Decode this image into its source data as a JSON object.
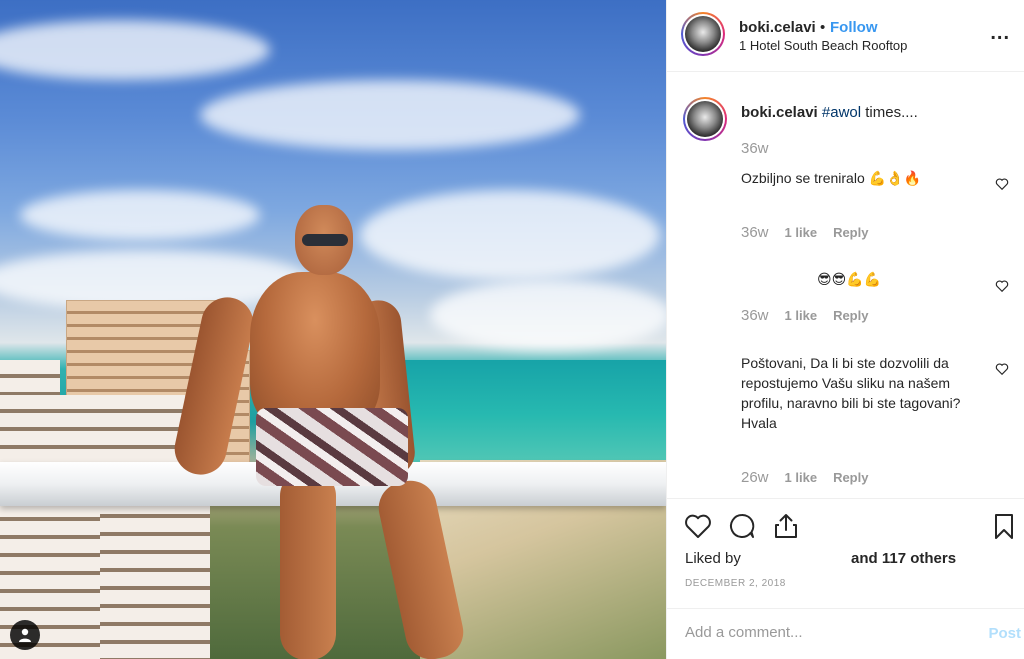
{
  "post": {
    "username": "boki.celavi",
    "dot": "•",
    "follow_label": "Follow",
    "location": "1 Hotel South Beach Rooftop",
    "more_label": "...",
    "caption_username": "boki.celavi",
    "caption_hashtag": "#awol",
    "caption_text": " times....",
    "caption_time": "36w"
  },
  "comments": [
    {
      "text": "Ozbiljno se treniralo 💪👌🔥",
      "time": "36w",
      "likes": "1 like",
      "reply": "Reply"
    },
    {
      "text": "😎😎💪💪",
      "time": "36w",
      "likes": "1 like",
      "reply": "Reply"
    },
    {
      "text": "Poštovani, Da li bi ste dozvolili da repostujemo Vašu sliku na našem profilu, naravno bili bi ste tagovani? Hvala",
      "time": "26w",
      "likes": "1 like",
      "reply": "Reply"
    }
  ],
  "actions": {
    "liked_by": "Liked by",
    "others": "and 117 others",
    "date": "DECEMBER 2, 2018"
  },
  "add_comment": {
    "placeholder": "Add a comment...",
    "post_label": "Post"
  },
  "icons": {
    "heart": "heart-icon",
    "comment": "comment-icon",
    "share": "share-icon",
    "bookmark": "bookmark-icon",
    "user_tag": "user-tag-icon"
  },
  "colors": {
    "follow": "#3897f0",
    "hashtag": "#003569",
    "muted": "#999999",
    "post_disabled": "#b2dffc"
  }
}
